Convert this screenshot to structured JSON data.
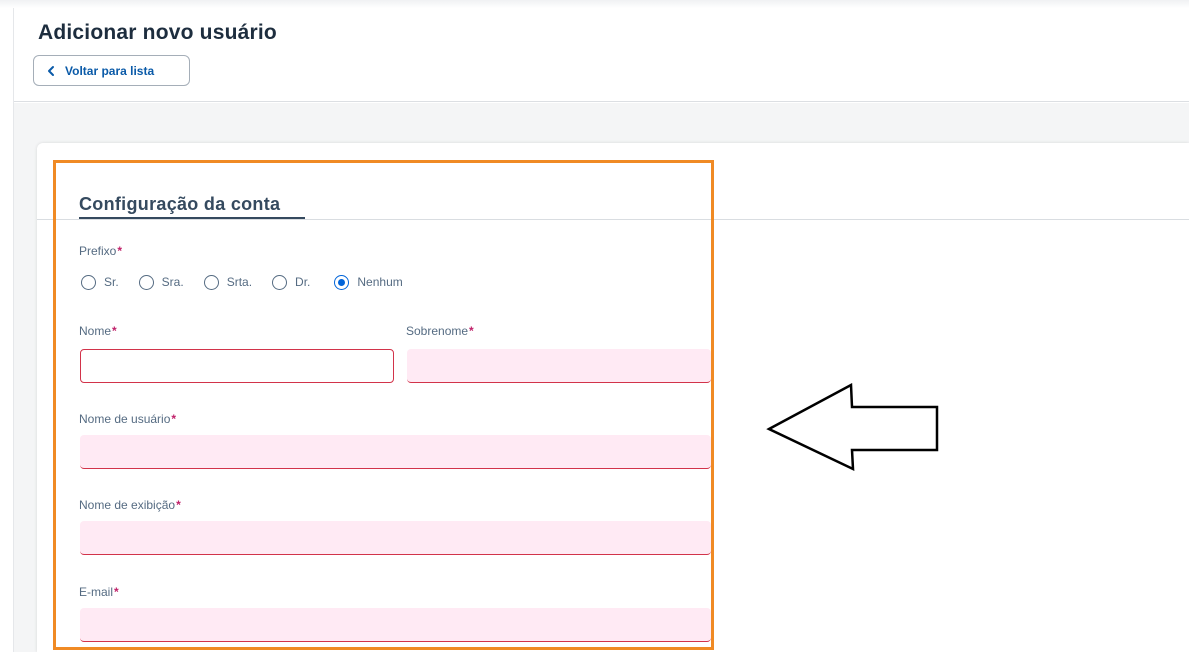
{
  "header": {
    "title": "Adicionar novo usuário",
    "back_label": "Voltar para lista"
  },
  "section": {
    "title": "Configuração da conta"
  },
  "form": {
    "prefix": {
      "label": "Prefixo",
      "required_mark": "*",
      "options": [
        "Sr.",
        "Sra.",
        "Srta.",
        "Dr.",
        "Nenhum"
      ],
      "selected": "Nenhum"
    },
    "first_name": {
      "label": "Nome",
      "required_mark": "*",
      "value": ""
    },
    "last_name": {
      "label": "Sobrenome",
      "required_mark": "*",
      "value": ""
    },
    "username": {
      "label": "Nome de usuário",
      "required_mark": "*",
      "value": ""
    },
    "display_name": {
      "label": "Nome de exibição",
      "required_mark": "*",
      "value": ""
    },
    "email": {
      "label": "E-mail",
      "required_mark": "*",
      "value": ""
    }
  },
  "colors": {
    "highlight": "#f08a24",
    "required": "#c0226a",
    "error_border": "#d2334a",
    "error_fill": "#ffeaf4",
    "link": "#0a5aa8"
  },
  "icons": {
    "back": "chevron-left-icon",
    "annotation": "left-arrow-icon"
  }
}
